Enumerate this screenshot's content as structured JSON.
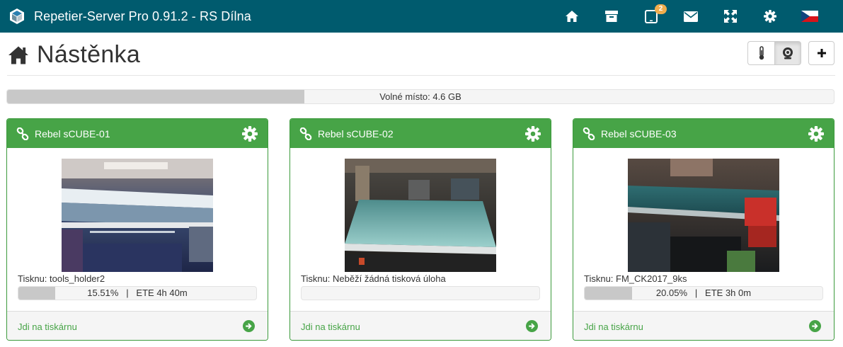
{
  "app": {
    "title": "Repetier-Server Pro 0.91.2 - RS Dílna",
    "nav": [
      {
        "icon": "home-icon"
      },
      {
        "icon": "archive-icon"
      },
      {
        "icon": "tablet-icon",
        "badge": "2"
      },
      {
        "icon": "envelope-icon"
      },
      {
        "icon": "fullscreen-icon"
      },
      {
        "icon": "gear-icon"
      },
      {
        "icon": "czech-flag-icon"
      }
    ],
    "colors": {
      "topbar": "#005b6e",
      "panel_header": "#47a447",
      "badge": "#f0ad4e"
    }
  },
  "page": {
    "title": "Nástěnka",
    "view_buttons": [
      {
        "icon": "thermometer-icon"
      },
      {
        "icon": "webcam-icon",
        "active": true
      }
    ],
    "add_button_icon": "plus-icon"
  },
  "disk": {
    "label": "Volné místo: 4.6 GB",
    "used_fraction": 0.36
  },
  "printers": [
    {
      "name": "Rebel sCUBE-01",
      "job": "Tisknu: tools_holder2",
      "progress_text": "15.51%   |   ETE 4h 40m",
      "progress": 15.51,
      "link": "Jdi na tiskárnu"
    },
    {
      "name": "Rebel sCUBE-02",
      "job": "Tisknu: Neběží žádná tisková úloha",
      "progress_text": "",
      "progress": 0,
      "link": "Jdi na tiskárnu"
    },
    {
      "name": "Rebel sCUBE-03",
      "job": "Tisknu: FM_CK2017_9ks",
      "progress_text": "20.05%   |   ETE 3h 0m",
      "progress": 20.05,
      "link": "Jdi na tiskárnu"
    }
  ]
}
